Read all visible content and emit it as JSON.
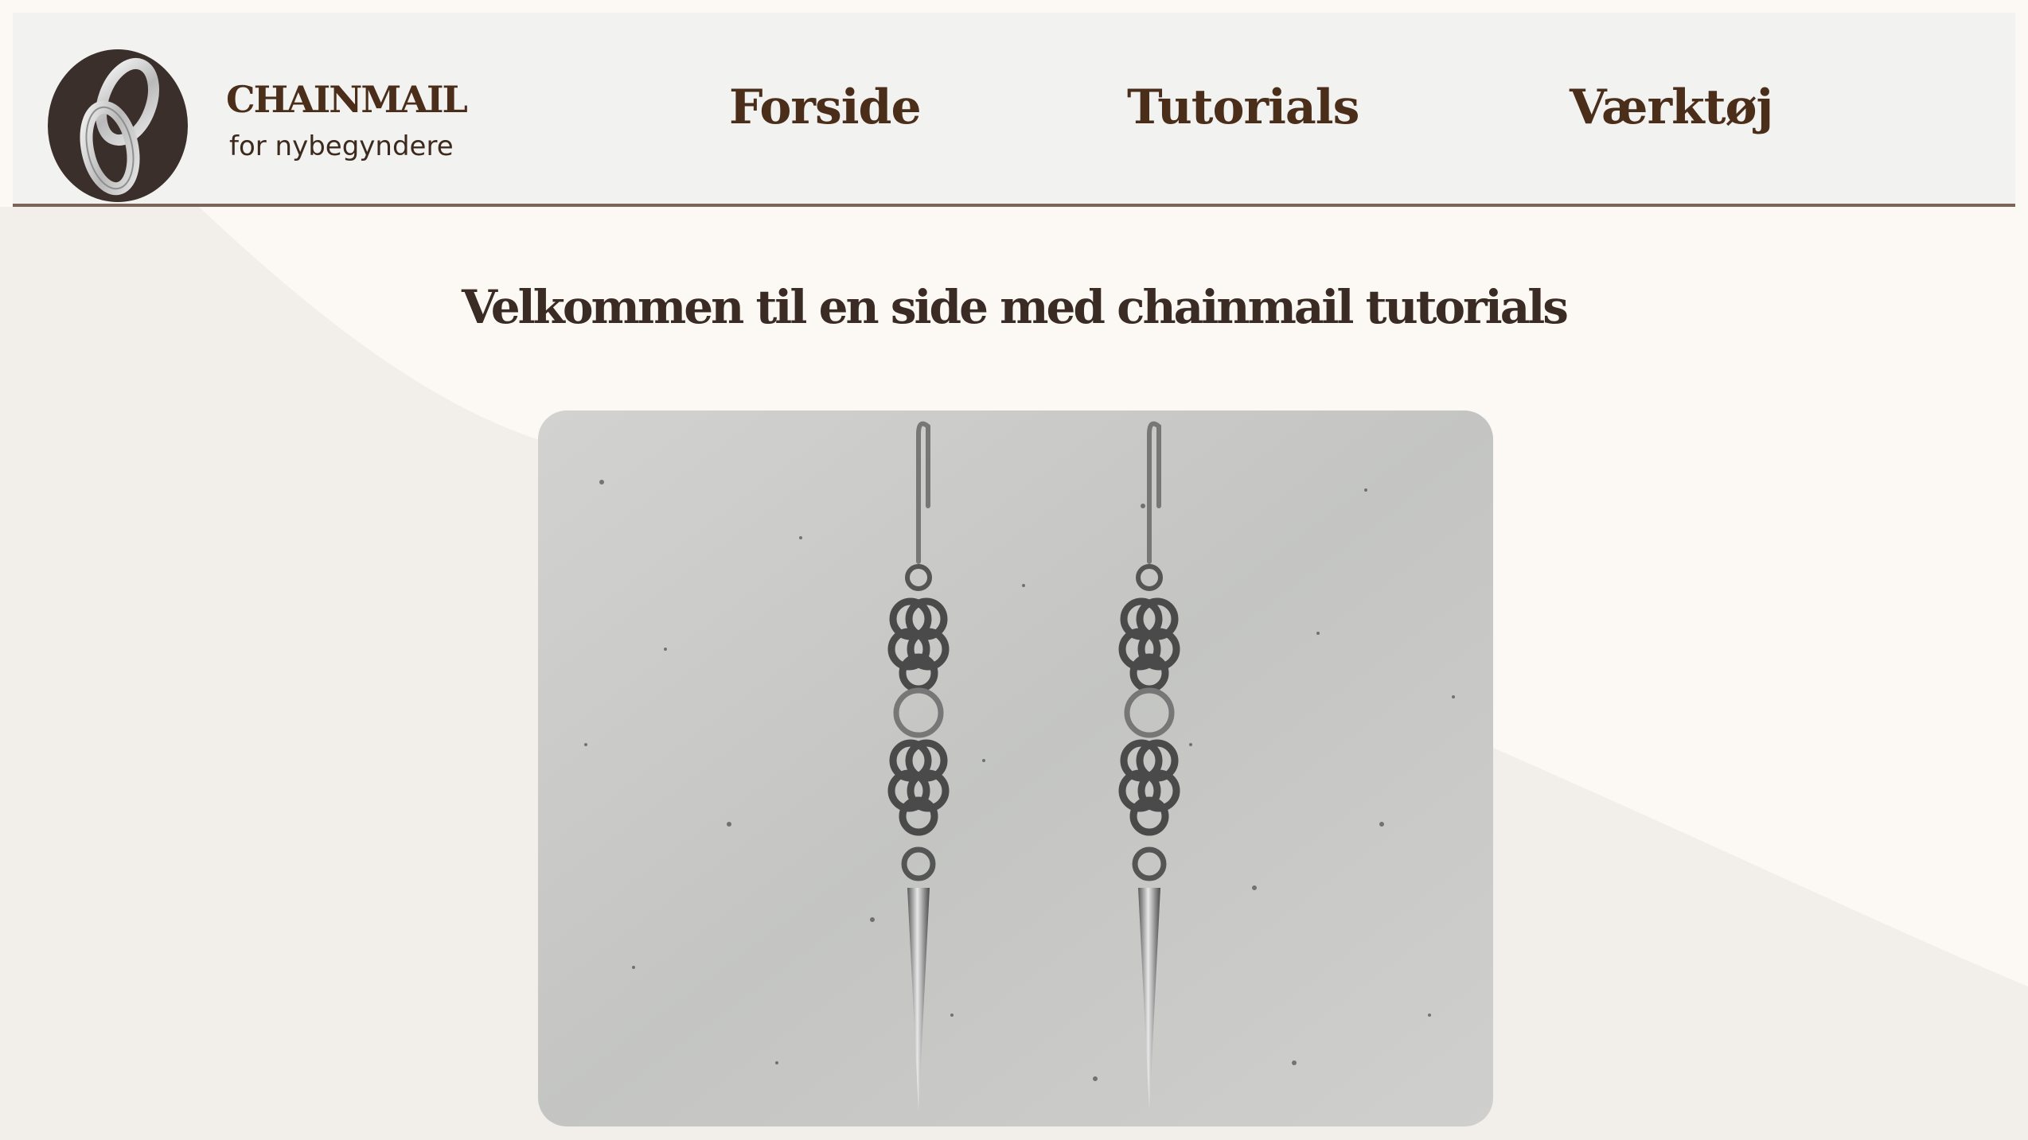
{
  "site": {
    "brand_title": "CHAINMAIL",
    "brand_subtitle": "for nybegyndere",
    "logo_icon": "chain-links-icon"
  },
  "nav": {
    "items": [
      {
        "label": "Forside"
      },
      {
        "label": "Tutorials"
      },
      {
        "label": "Værktøj"
      }
    ]
  },
  "main": {
    "heading": "Velkommen til en side med chainmail tutorials",
    "hero_image": "chainmail-earrings-photo"
  },
  "colors": {
    "page_background": "#fcf9f4",
    "background_shape": "#f2efeb",
    "header_background": "#f2f2f1",
    "header_border": "#7a6658",
    "brand_brown": "#4a2e1a",
    "heading_text": "#3a2b24"
  }
}
